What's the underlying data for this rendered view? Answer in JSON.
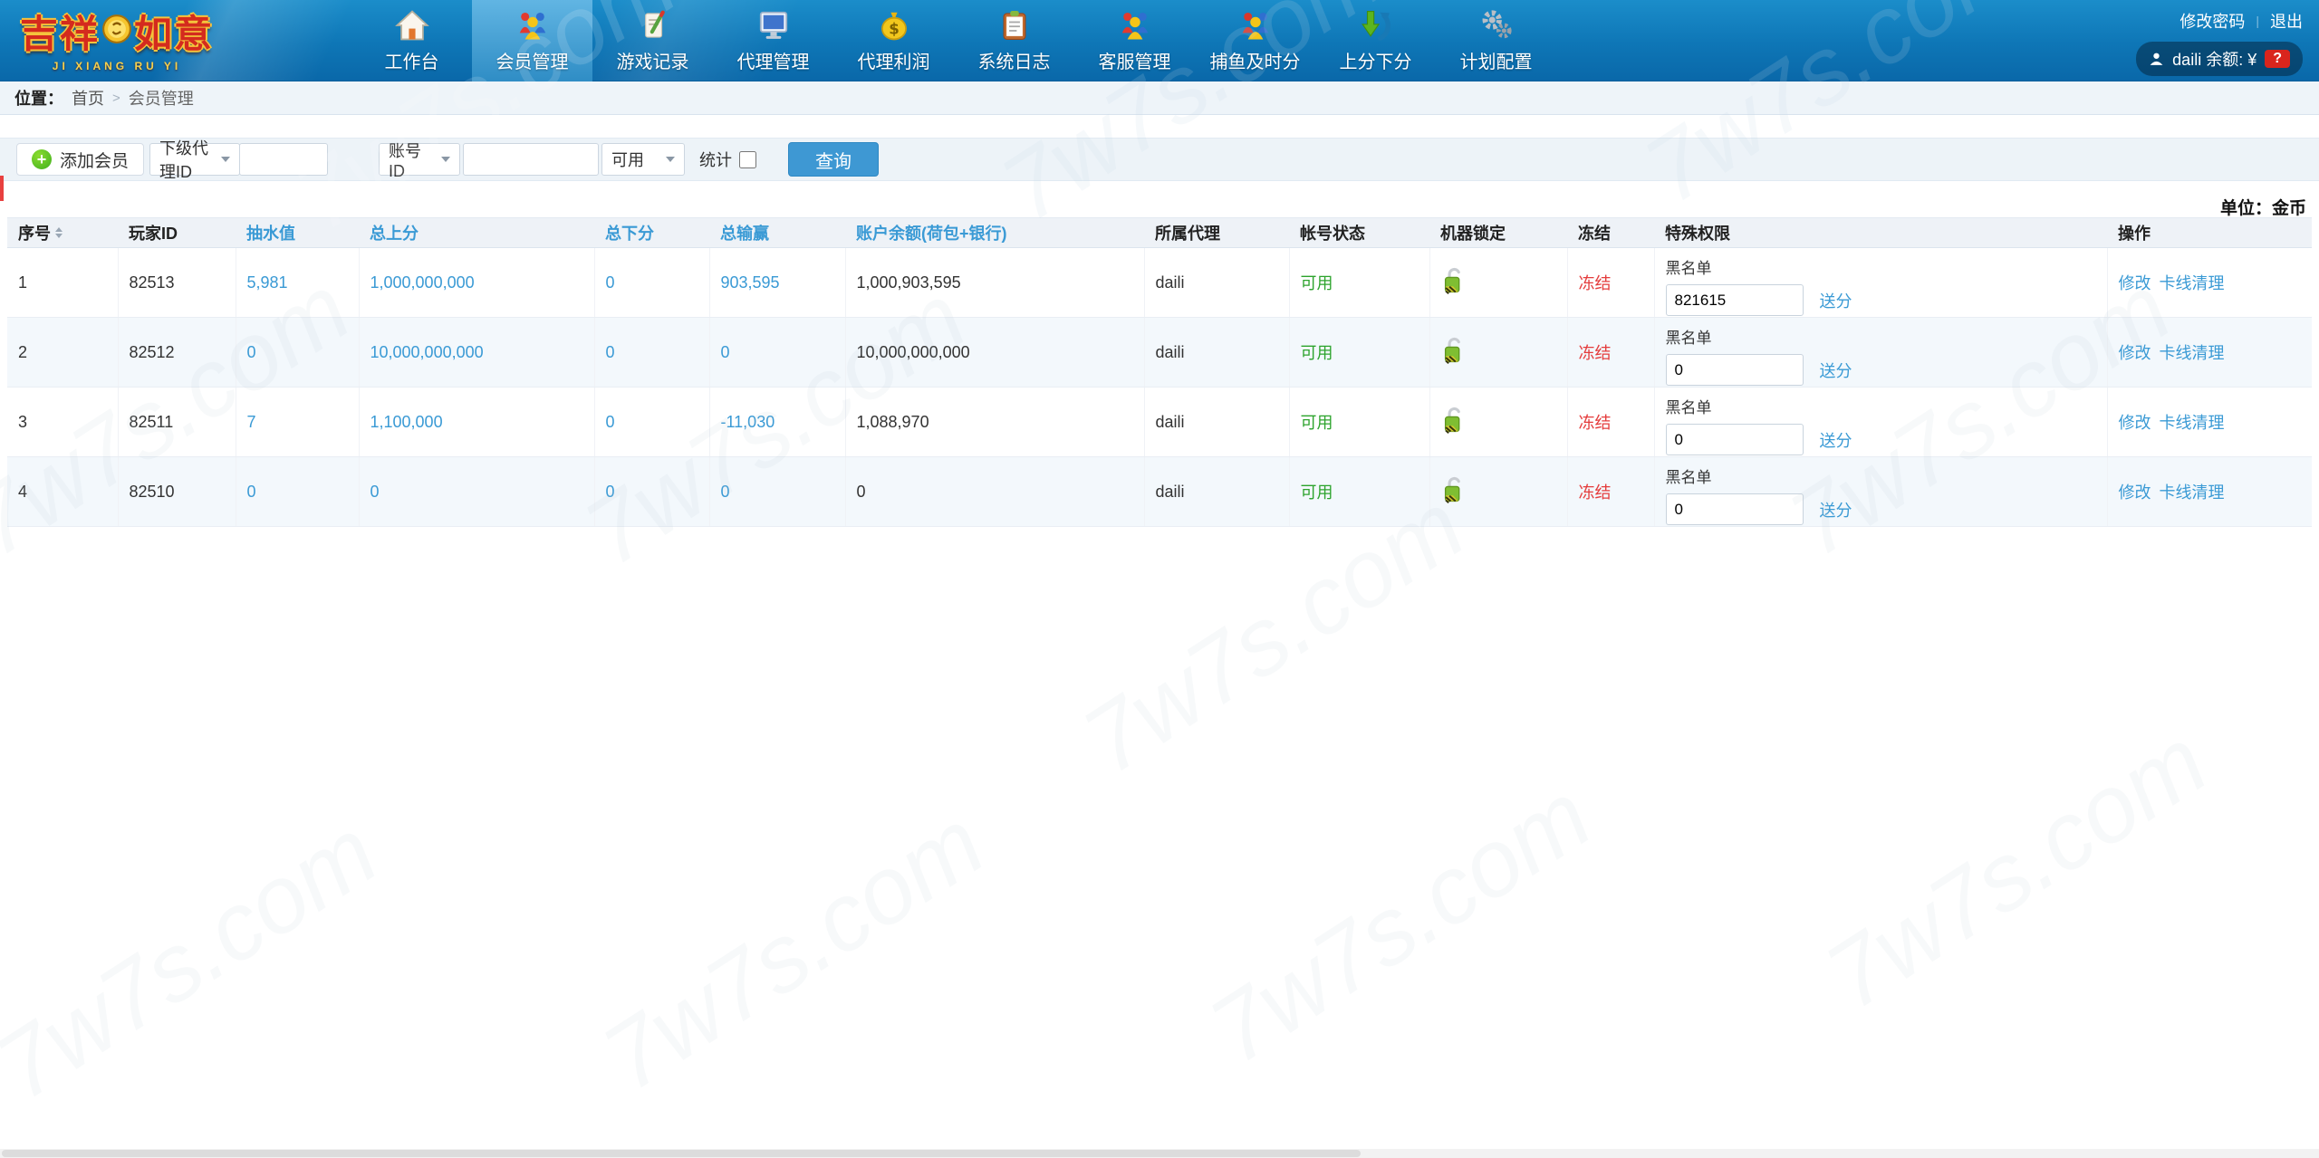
{
  "navbar": {
    "logo": {
      "title_left": "吉祥",
      "title_right": "如意",
      "subtitle": "JI XIANG RU YI"
    },
    "items": [
      {
        "label": "工作台",
        "icon": "home-icon",
        "active": false
      },
      {
        "label": "会员管理",
        "icon": "members-icon",
        "active": true
      },
      {
        "label": "游戏记录",
        "icon": "game-record-icon",
        "active": false
      },
      {
        "label": "代理管理",
        "icon": "agent-manage-icon",
        "active": false
      },
      {
        "label": "代理利润",
        "icon": "agent-profit-icon",
        "active": false
      },
      {
        "label": "系统日志",
        "icon": "system-log-icon",
        "active": false
      },
      {
        "label": "客服管理",
        "icon": "customer-service-icon",
        "active": false
      },
      {
        "label": "捕鱼及时分",
        "icon": "fishing-score-icon",
        "active": false
      },
      {
        "label": "上分下分",
        "icon": "score-updown-icon",
        "active": false
      },
      {
        "label": "计划配置",
        "icon": "plan-config-icon",
        "active": false
      }
    ],
    "change_password": "修改密码",
    "logout": "退出",
    "user_info": "daili 余额: ¥",
    "user_badge": "?"
  },
  "breadcrumb": {
    "prefix": "位置：",
    "home": "首页",
    "separator": ">",
    "current": "会员管理"
  },
  "toolbar": {
    "add_member": "添加会员",
    "agent_filter": "下级代理ID",
    "agent_filter_value": "",
    "account_filter": "账号ID",
    "account_filter_value": "",
    "status_filter": "可用",
    "stats_label": "统计",
    "search_button": "查询"
  },
  "table": {
    "unit_label": "单位：金币",
    "headers": [
      "序号",
      "玩家ID",
      "抽水值",
      "总上分",
      "总下分",
      "总输赢",
      "账户余额(荷包+银行)",
      "所属代理",
      "帐号状态",
      "机器锁定",
      "冻结",
      "特殊权限",
      "操作"
    ],
    "blacklist_label": "黑名单",
    "send_score_link": "送分",
    "modify_link": "修改",
    "clear_link": "卡线清理",
    "rows": [
      {
        "seq": "1",
        "player_id": "82513",
        "pump": "5,981",
        "total_up": "1,000,000,000",
        "total_down": "0",
        "total_win": "903,595",
        "balance": "1,000,903,595",
        "agent": "daili",
        "status": "可用",
        "freeze": "冻结",
        "blacklist": "821615"
      },
      {
        "seq": "2",
        "player_id": "82512",
        "pump": "0",
        "total_up": "10,000,000,000",
        "total_down": "0",
        "total_win": "0",
        "balance": "10,000,000,000",
        "agent": "daili",
        "status": "可用",
        "freeze": "冻结",
        "blacklist": "0"
      },
      {
        "seq": "3",
        "player_id": "82511",
        "pump": "7",
        "total_up": "1,100,000",
        "total_down": "0",
        "total_win": "-11,030",
        "balance": "1,088,970",
        "agent": "daili",
        "status": "可用",
        "freeze": "冻结",
        "blacklist": "0"
      },
      {
        "seq": "4",
        "player_id": "82510",
        "pump": "0",
        "total_up": "0",
        "total_down": "0",
        "total_win": "0",
        "balance": "0",
        "agent": "daili",
        "status": "可用",
        "freeze": "冻结",
        "blacklist": "0"
      }
    ]
  },
  "watermark": "7w7s.com",
  "colors": {
    "nav_blue": "#0e76b6",
    "active_item_blue": "#4aa5da",
    "link_blue": "#3a9ad5",
    "status_green": "#2ca32c",
    "freeze_red": "#e43c3c",
    "search_button_blue": "#3e98d3",
    "badge_red": "#d9251d"
  }
}
